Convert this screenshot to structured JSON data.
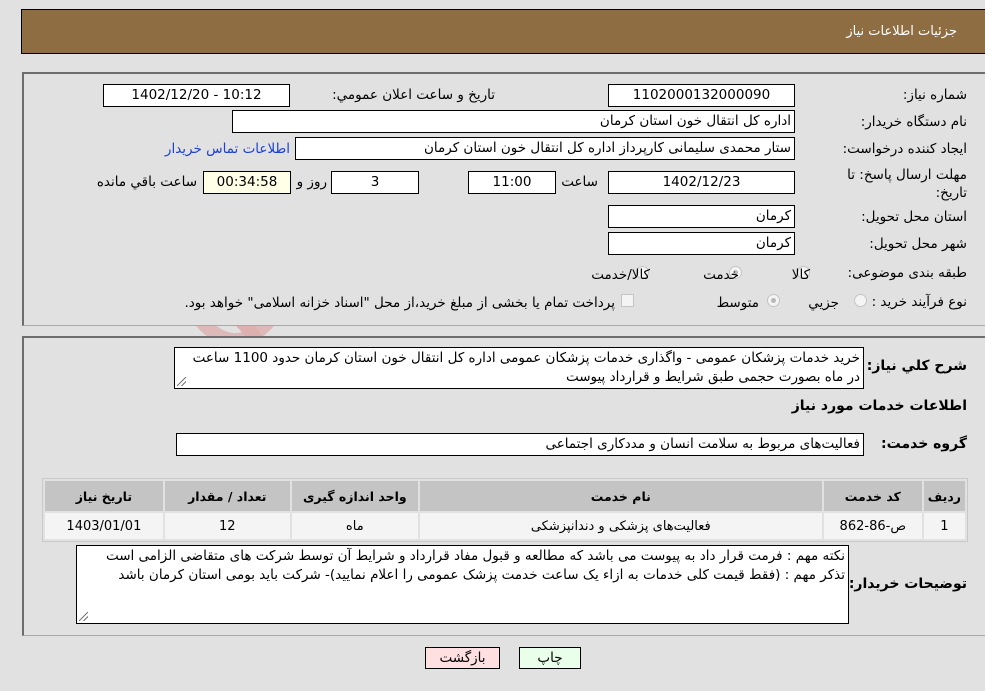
{
  "header": {
    "title": "جزئیات اطلاعات نیاز"
  },
  "details": {
    "need_number_label": "شماره نیاز:",
    "need_number": "1102000132000090",
    "announce_label": "تاريخ و ساعت اعلان عمومي:",
    "announce_value": "1402/12/20 - 10:12",
    "buyer_org_label": "نام دستگاه خریدار:",
    "buyer_org": "اداره کل انتقال خون استان کرمان",
    "requester_label": "ایجاد کننده درخواست:",
    "requester": "ستار محمدی سلیمانی کارپرداز اداره کل انتقال خون استان کرمان",
    "contact_link": "اطلاعات تماس خریدار",
    "deadline_label": "مهلت ارسال پاسخ: تا تاریخ:",
    "deadline_date": "1402/12/23",
    "time_label": "ساعت",
    "deadline_time": "11:00",
    "days_value": "3",
    "days_label": "روز و",
    "remaining_time": "00:34:58",
    "remaining_label": "ساعت باقي مانده",
    "province_label": "استان محل تحویل:",
    "province": "کرمان",
    "city_label": "شهر محل تحویل:",
    "city": "کرمان",
    "category_label": "طبقه بندی موضوعی:",
    "category_options": [
      {
        "label": "کالا",
        "selected": false
      },
      {
        "label": "خدمت",
        "selected": true
      },
      {
        "label": "کالا/خدمت",
        "selected": false
      }
    ],
    "process_label": "نوع فرآیند خرید :",
    "process_options": [
      {
        "label": "جزيي",
        "selected": false
      },
      {
        "label": "متوسط",
        "selected": true
      }
    ],
    "payment_checkbox_label": "پرداخت تمام یا بخشی از مبلغ خرید،از محل \"اسناد خزانه اسلامی\" خواهد بود.",
    "payment_checked": false
  },
  "description": {
    "label": "شرح کلي نياز:",
    "text": "خرید خدمات پزشکان عمومی - واگذاری خدمات پزشکان عمومی اداره کل انتقال خون استان کرمان حدود 1100 ساعت در ماه بصورت حجمی طبق شرایط و قرارداد پیوست"
  },
  "services": {
    "section_title": "اطلاعات خدمات مورد نیاز",
    "group_label": "گروه خدمت:",
    "group_value": "فعالیت‌های مربوط به سلامت انسان و مددکاری اجتماعی",
    "table": {
      "headers": [
        "ردیف",
        "کد خدمت",
        "نام خدمت",
        "واحد اندازه گیری",
        "تعداد / مقدار",
        "تاریخ نیاز"
      ],
      "rows": [
        [
          "1",
          "ص-86-862",
          "فعالیت‌های پزشکی و دندانپزشکی",
          "ماه",
          "12",
          "1403/01/01"
        ]
      ]
    }
  },
  "buyer_notes": {
    "label": "توضیحات خریدار:",
    "line1": "نکته مهم : فرمت قرار داد به پیوست می باشد که مطالعه و قبول مفاد قرارداد و شرایط آن توسط شرکت های متقاضی الزامی است",
    "line2": "تذکر مهم : (فقط قیمت کلی خدمات به ازاء یک ساعت خدمت پزشک عمومی را اعلام نمایید)- شرکت باید بومی استان کرمان باشد"
  },
  "buttons": {
    "print": "چاپ",
    "back": "بازگشت"
  },
  "watermark": {
    "text": "AriaTender.neT"
  },
  "colors": {
    "header_bg": "#8e6d42",
    "link": "#1c3fd4",
    "back_btn": "#ffe0e0",
    "print_btn": "#eaffea",
    "remaining_bg": "#ffffe8"
  }
}
